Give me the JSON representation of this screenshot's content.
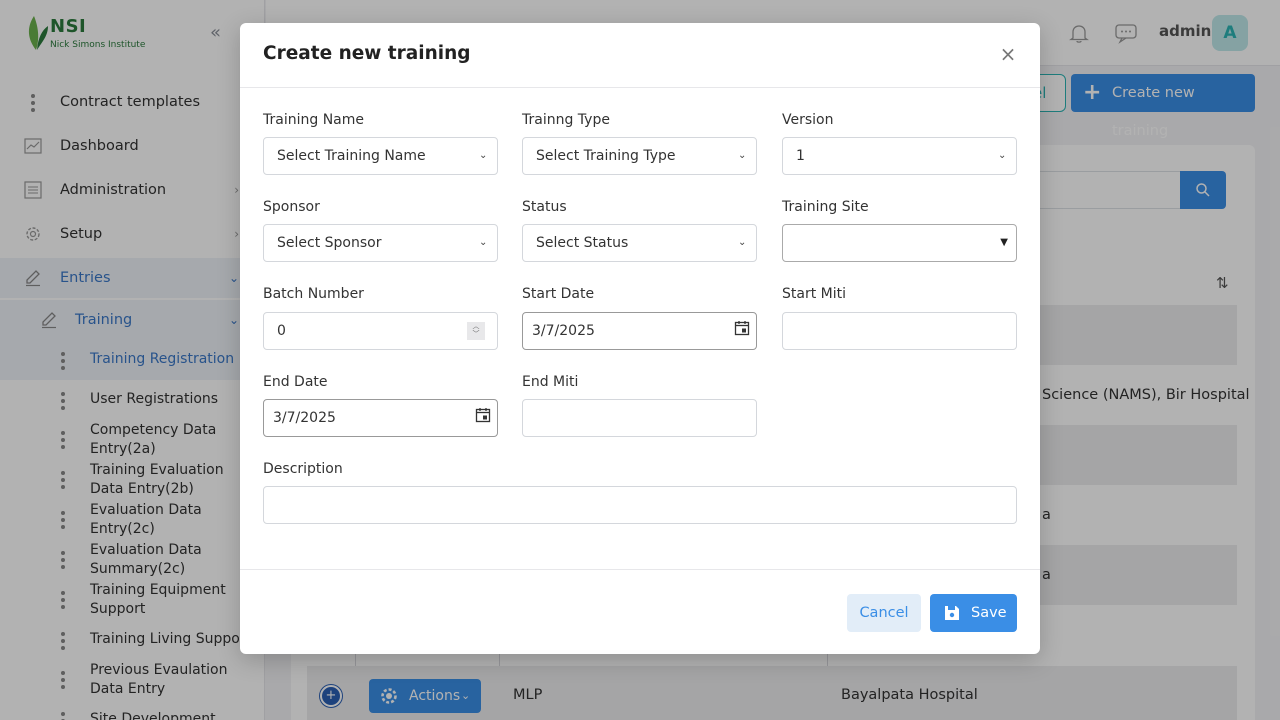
{
  "brand": {
    "logo_text": "NSI",
    "logo_sub": "Nick Simons Institute"
  },
  "sidebar": {
    "items": [
      {
        "label": "Contract templates",
        "icon": "dots-icon"
      },
      {
        "label": "Dashboard",
        "icon": "chart-icon"
      },
      {
        "label": "Administration",
        "icon": "list-icon"
      },
      {
        "label": "Setup",
        "icon": "gear-icon"
      },
      {
        "label": "Entries",
        "icon": "edit-icon"
      },
      {
        "label": "Training",
        "icon": "edit-icon"
      }
    ],
    "entries_children": [
      {
        "label": "Training Registration"
      },
      {
        "label": "User Registrations"
      },
      {
        "label": "Competency Data Entry(2a)"
      },
      {
        "label": "Training Evaluation Data Entry(2b)"
      },
      {
        "label": "Evaluation Data Entry(2c)"
      },
      {
        "label": "Evaluation Data Summary(2c)"
      },
      {
        "label": "Training Equipment Support"
      },
      {
        "label": "Training Living Support"
      },
      {
        "label": "Previous Evaulation Data Entry"
      },
      {
        "label": "Site Development"
      }
    ]
  },
  "topbar": {
    "username": "admin",
    "avatar_letter": "A"
  },
  "page": {
    "partial_button_label": "el",
    "create_button_label": "Create new training",
    "rows": [
      {
        "text": "Science (NAMS), Bir Hospital"
      },
      {
        "text": "a"
      },
      {
        "text": "a"
      }
    ],
    "last_row": {
      "actions_label": "Actions",
      "col2": "MLP",
      "col3": "Bayalpata Hospital"
    }
  },
  "modal": {
    "title": "Create new training",
    "fields": {
      "training_name": {
        "label": "Training Name",
        "value": "Select Training Name"
      },
      "training_type": {
        "label": "Trainng Type",
        "value": "Select Training Type"
      },
      "version": {
        "label": "Version",
        "value": "1"
      },
      "sponsor": {
        "label": "Sponsor",
        "value": "Select Sponsor"
      },
      "status": {
        "label": "Status",
        "value": "Select Status"
      },
      "training_site": {
        "label": "Training Site",
        "value": ""
      },
      "batch_number": {
        "label": "Batch Number",
        "value": "0"
      },
      "start_date": {
        "label": "Start Date",
        "value": "3/7/2025"
      },
      "start_miti": {
        "label": "Start Miti",
        "value": ""
      },
      "end_date": {
        "label": "End Date",
        "value": "3/7/2025"
      },
      "end_miti": {
        "label": "End Miti",
        "value": ""
      },
      "description": {
        "label": "Description",
        "value": ""
      }
    },
    "cancel_label": "Cancel",
    "save_label": "Save"
  },
  "colors": {
    "primary": "#3a8ee6",
    "teal": "#2bb3b3",
    "brand_green": "#2b7a3d"
  }
}
